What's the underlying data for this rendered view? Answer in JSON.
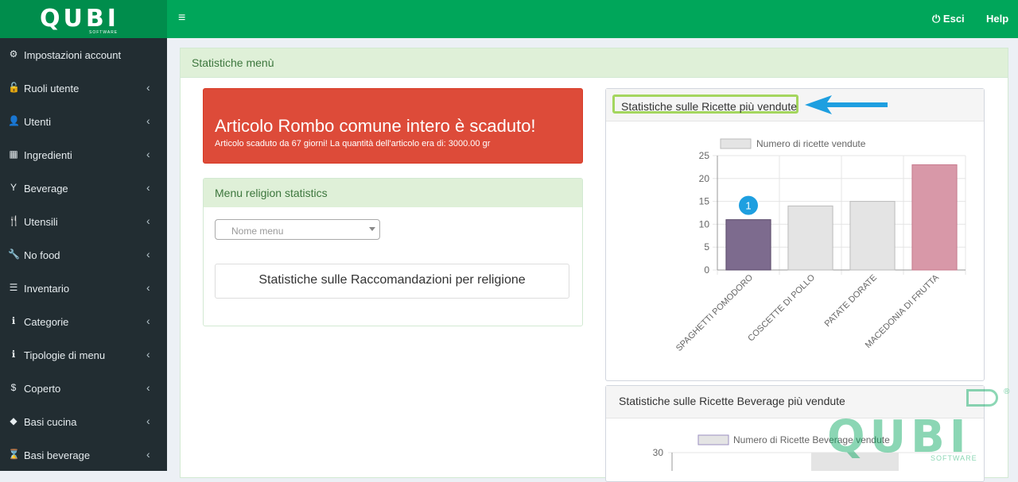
{
  "brand": {
    "logo": "QUBI",
    "logo_sub": "SOFTWARE"
  },
  "topbar": {
    "exit_label": "Esci",
    "help_label": "Help"
  },
  "sidebar": {
    "items": [
      {
        "label": "Impostazioni account",
        "icon": "gear-icon",
        "glyph": "⚙"
      },
      {
        "label": "Ruoli utente",
        "icon": "unlock-icon",
        "glyph": "🔓"
      },
      {
        "label": "Utenti",
        "icon": "user-icon",
        "glyph": "👤"
      },
      {
        "label": "Ingredienti",
        "icon": "cubes-icon",
        "glyph": "▦"
      },
      {
        "label": "Beverage",
        "icon": "glass-icon",
        "glyph": "Y"
      },
      {
        "label": "Utensili",
        "icon": "cutlery-icon",
        "glyph": "🍴"
      },
      {
        "label": "No food",
        "icon": "wrench-icon",
        "glyph": "🔧"
      },
      {
        "label": "Inventario",
        "icon": "list-icon",
        "glyph": "☰"
      },
      {
        "label": "Categorie",
        "icon": "info-icon",
        "glyph": "ℹ"
      },
      {
        "label": "Tipologie di menu",
        "icon": "info-icon",
        "glyph": "ℹ"
      },
      {
        "label": "Coperto",
        "icon": "dollar-icon",
        "glyph": "$"
      },
      {
        "label": "Basi cucina",
        "icon": "cube-icon",
        "glyph": "◆"
      },
      {
        "label": "Basi beverage",
        "icon": "hourglass-icon",
        "glyph": "⌛"
      }
    ]
  },
  "main": {
    "title": "Statistiche menù",
    "alert": {
      "title": "Articolo Rombo comune intero è scaduto!",
      "subtitle": "Articolo scaduto da 67 giorni! La quantità dell'articolo era di: 3000.00 gr"
    },
    "religion_box": {
      "title": "Menu religion statistics",
      "select_placeholder": "Nome menu",
      "button_label": "Statistiche sulle Raccomandazioni per religione"
    },
    "chart_box": {
      "title": "Statistiche sulle Ricette più vendute",
      "marker": "1"
    },
    "beverage_box": {
      "title": "Statistiche sulle Ricette Beverage più vendute"
    }
  },
  "chart_data": [
    {
      "type": "bar",
      "legend": [
        "Numero di ricette vendute"
      ],
      "categories": [
        "SPAGHETTI POMODORO",
        "COSCETTE DI POLLO",
        "PATATE DORATE",
        "MACEDONIA DI FRUTTA"
      ],
      "series": [
        {
          "name": "Numero di ricette vendute",
          "values": [
            11,
            14,
            15,
            23
          ]
        }
      ],
      "yticks": [
        "0",
        "5",
        "10",
        "15",
        "20",
        "25"
      ],
      "ylim": [
        0,
        25
      ],
      "colors": [
        "#7d6b8e",
        "#e4e4e4",
        "#e4e4e4",
        "#d898a8"
      ],
      "grid": true,
      "legend_position": "top"
    },
    {
      "type": "bar",
      "legend": [
        "Numero di Ricette Beverage vendute"
      ],
      "yticks": [
        "30"
      ],
      "grid": true,
      "legend_position": "top"
    }
  ]
}
